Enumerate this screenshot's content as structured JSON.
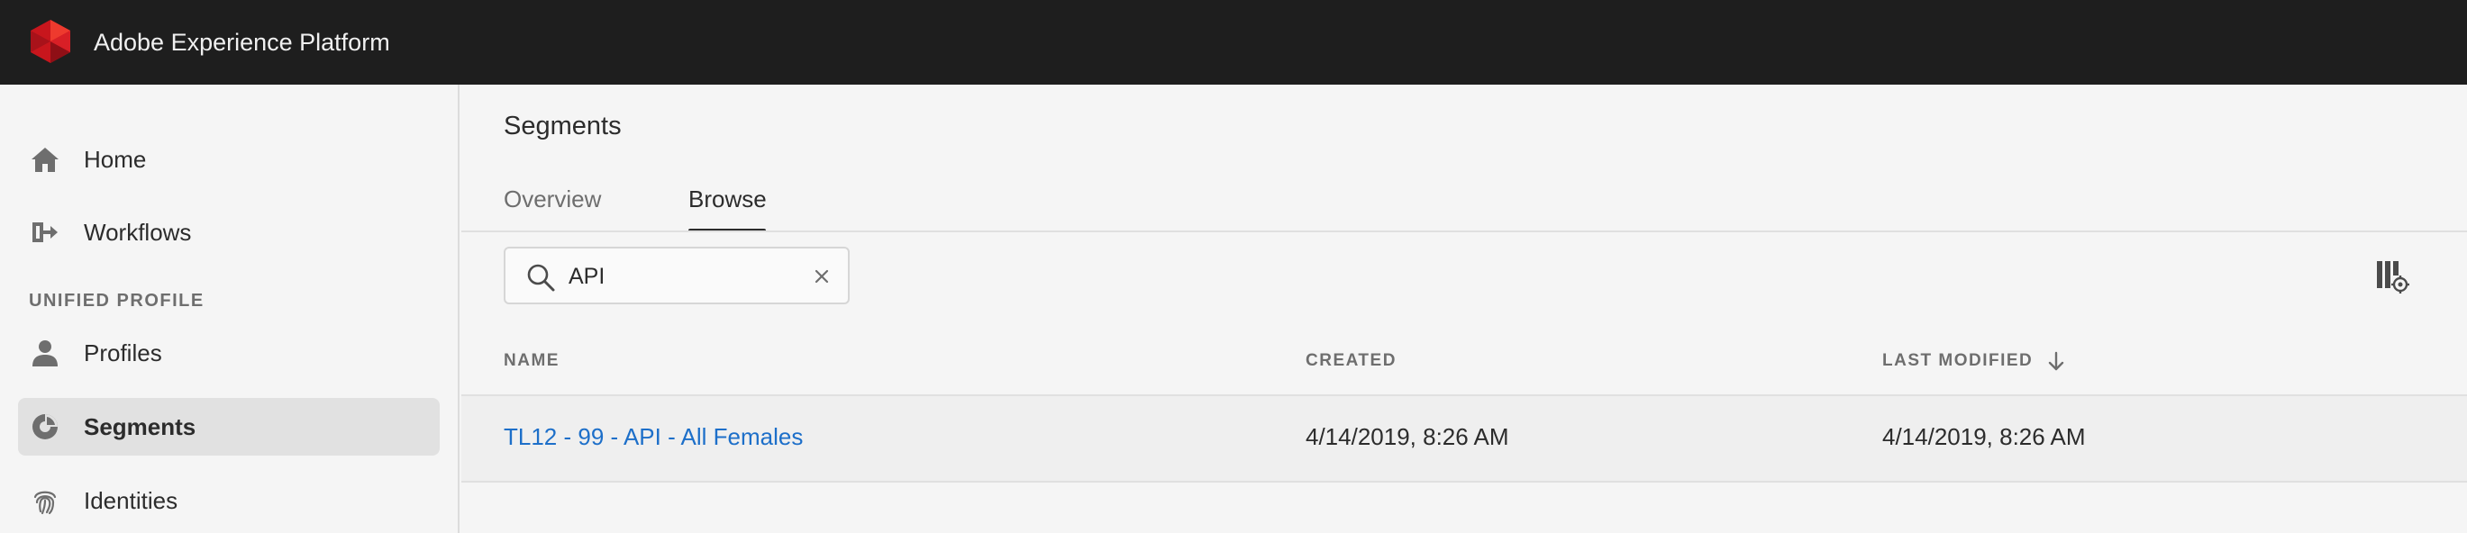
{
  "header": {
    "app_title": "Adobe Experience Platform",
    "logo_icon": "adobe-logo-icon",
    "brand_color": "#e1251b"
  },
  "sidebar": {
    "items": [
      {
        "label": "Home",
        "icon": "home-icon"
      },
      {
        "label": "Workflows",
        "icon": "workflows-icon"
      },
      {
        "label": "Profiles",
        "icon": "person-icon"
      },
      {
        "label": "Segments",
        "icon": "segments-icon",
        "active": true
      },
      {
        "label": "Identities",
        "icon": "fingerprint-icon"
      }
    ],
    "section_label": "UNIFIED PROFILE"
  },
  "main": {
    "page_title": "Segments",
    "tabs": [
      {
        "label": "Overview",
        "active": false
      },
      {
        "label": "Browse",
        "active": true
      }
    ],
    "search": {
      "value": "API",
      "placeholder": ""
    },
    "table": {
      "headers": {
        "name": "NAME",
        "created": "CREATED",
        "last_modified": "LAST MODIFIED"
      },
      "sort": {
        "column": "last_modified",
        "direction": "descending"
      },
      "rows": [
        {
          "name": "TL12 - 99 - API - All Females",
          "created": "4/14/2019, 8:26 AM",
          "last_modified": "4/14/2019, 8:26 AM"
        }
      ]
    },
    "link_color": "#1d6fc9"
  }
}
